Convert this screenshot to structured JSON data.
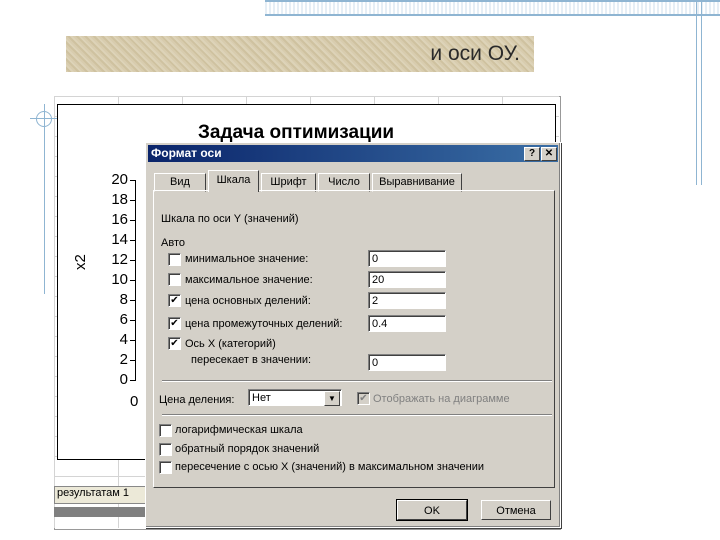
{
  "slide": {
    "title": "и оси ОУ."
  },
  "chart": {
    "title": "Задача оптимизации",
    "ylabel": "x2",
    "yticks": [
      "20",
      "18",
      "16",
      "14",
      "12",
      "10",
      "8",
      "6",
      "4",
      "2",
      "0"
    ],
    "xtick0": "0"
  },
  "sheet": {
    "tab_label": "результатам 1"
  },
  "dialog": {
    "title": "Формат оси",
    "help_btn": "?",
    "close_btn": "✕",
    "tabs": [
      "Вид",
      "Шкала",
      "Шрифт",
      "Число",
      "Выравнивание"
    ],
    "active_tab": "Шкала",
    "scale_heading": "Шкала по оси Y (значений)",
    "auto_label": "Авто",
    "rows": [
      {
        "label": "минимальное значение:",
        "checked": false,
        "value": "0"
      },
      {
        "label": "максимальное значение:",
        "checked": false,
        "value": "20"
      },
      {
        "label": "цена основных делений:",
        "checked": true,
        "value": "2"
      },
      {
        "label": "цена промежуточных делений:",
        "checked": true,
        "value": "0.4"
      },
      {
        "label": "Ось X (категорий)",
        "checked": true,
        "value": ""
      }
    ],
    "crosses_label": "пересекает в значении:",
    "crosses_value": "0",
    "units_label": "Цена деления:",
    "units_value": "Нет",
    "show_on_chart_label": "Отображать на диаграмме",
    "options": [
      {
        "label": "логарифмическая шкала",
        "checked": false
      },
      {
        "label": "обратный порядок значений",
        "checked": false
      },
      {
        "label": "пересечение с осью X (значений) в максимальном значении",
        "checked": false
      }
    ],
    "ok_label": "OK",
    "cancel_label": "Отмена"
  }
}
